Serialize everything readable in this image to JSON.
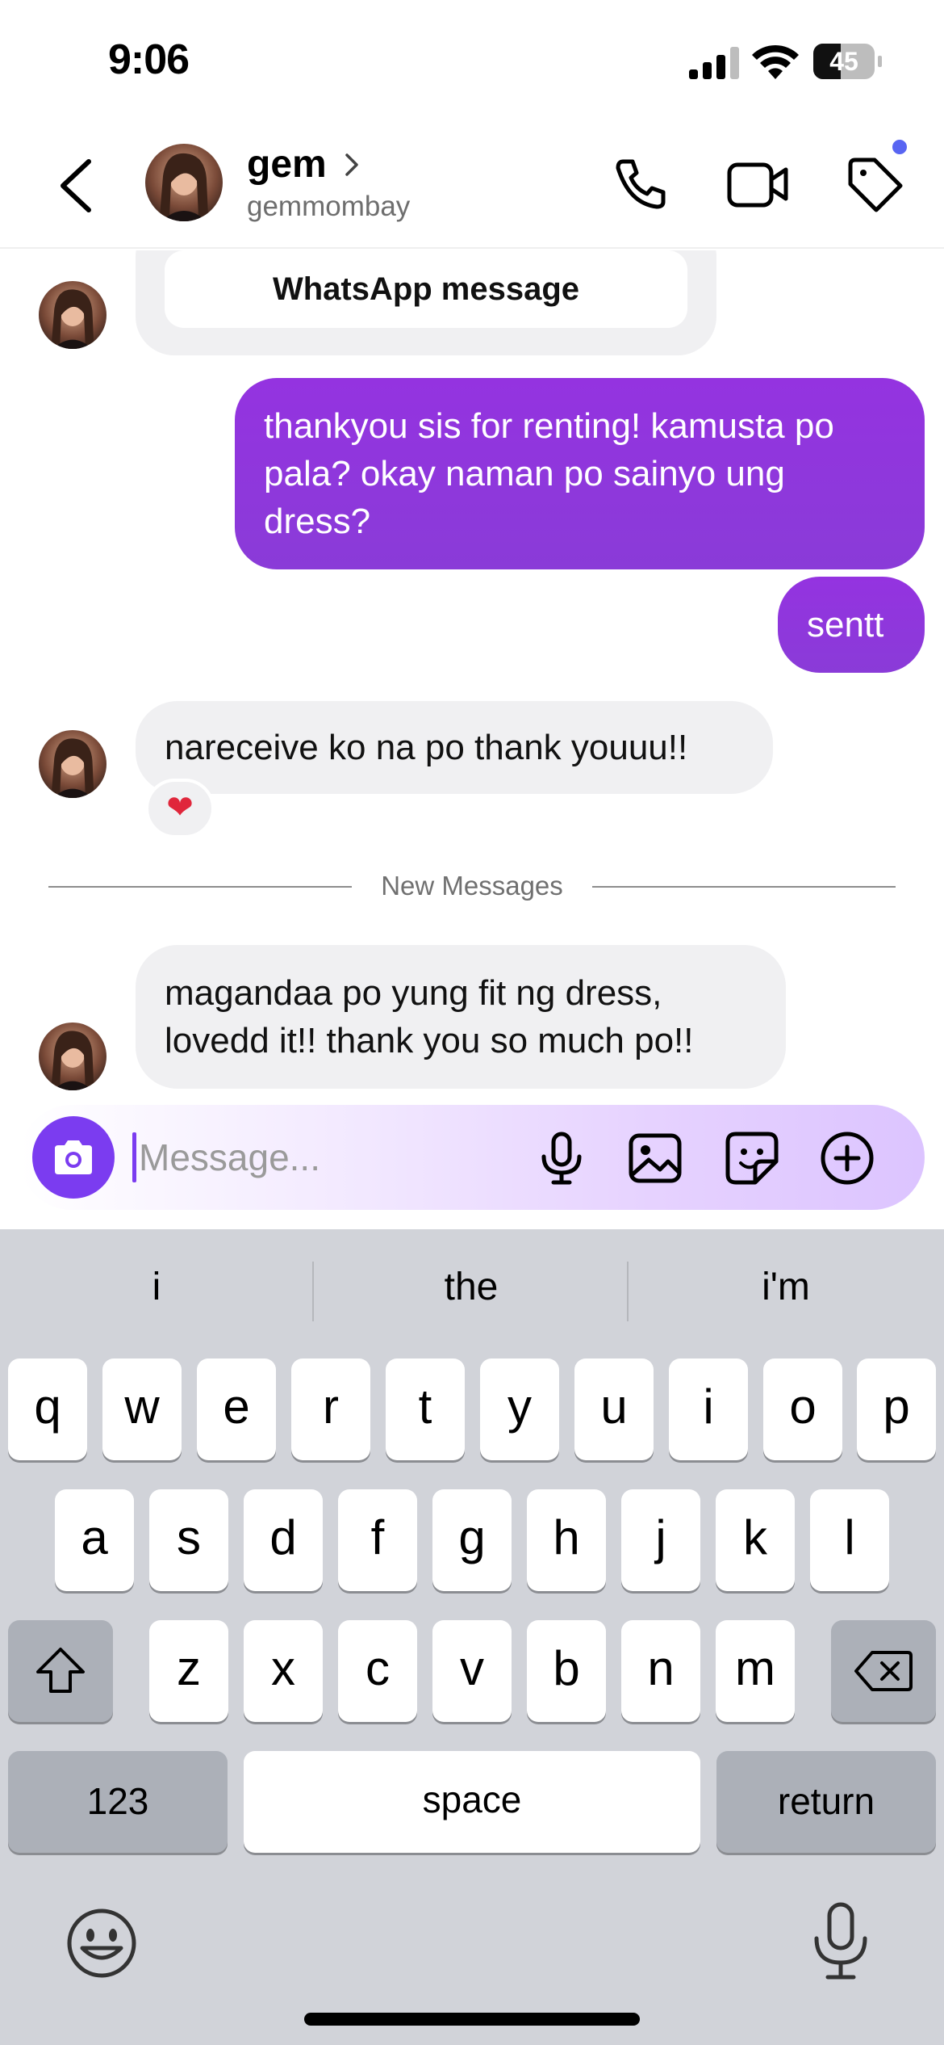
{
  "status_bar": {
    "time": "9:06",
    "battery_percent": "45",
    "battery_level": 0.45,
    "signal_bars_active": 3,
    "signal_bars_total": 4
  },
  "header": {
    "contact_name": "gem",
    "contact_handle": "gemmombay",
    "icons": [
      "back-chevron-icon",
      "phone-icon",
      "video-camera-icon",
      "tag-icon"
    ],
    "notification_dot_color": "#5865f2"
  },
  "messages": {
    "whatsapp_card_label": "WhatsApp message",
    "outgoing_1": "thankyou sis for renting! kamusta po pala? okay naman po sainyo ung dress?",
    "outgoing_2": "sentt",
    "incoming_1": "nareceive ko na po thank youuu!!",
    "incoming_1_reaction": "❤",
    "new_messages_divider": "New Messages",
    "incoming_2": "magandaa po yung fit ng dress, lovedd it!! thank you so much po!!"
  },
  "composer": {
    "placeholder": "Message...",
    "value": "",
    "icons": [
      "camera-icon",
      "microphone-icon",
      "gallery-icon",
      "sticker-icon",
      "plus-circle-icon"
    ]
  },
  "keyboard": {
    "suggestions": [
      "i",
      "the",
      "i'm"
    ],
    "row1": [
      "q",
      "w",
      "e",
      "r",
      "t",
      "y",
      "u",
      "i",
      "o",
      "p"
    ],
    "row2": [
      "a",
      "s",
      "d",
      "f",
      "g",
      "h",
      "j",
      "k",
      "l"
    ],
    "row3": [
      "z",
      "x",
      "c",
      "v",
      "b",
      "n",
      "m"
    ],
    "numbers_label": "123",
    "space_label": "space",
    "return_label": "return"
  },
  "colors": {
    "outgoing_bubble": "#9036de",
    "incoming_bubble": "#f0f0f2",
    "accent": "#7b3cf0",
    "keyboard_bg": "#d1d3d9"
  }
}
